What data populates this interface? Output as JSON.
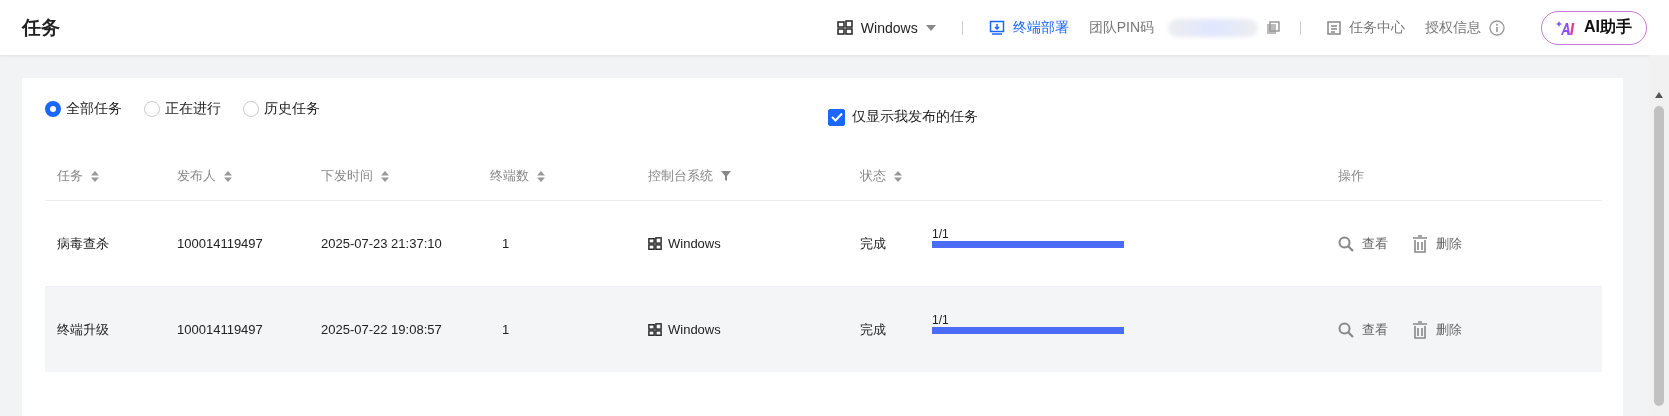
{
  "header": {
    "title": "任务",
    "os_selector": "Windows",
    "deploy_link": "终端部署",
    "team_pin_label": "团队PIN码",
    "task_center": "任务中心",
    "license_info": "授权信息",
    "ai_button": "AI助手"
  },
  "filters": [
    {
      "label": "全部任务",
      "selected": true
    },
    {
      "label": "正在进行",
      "selected": false
    },
    {
      "label": "历史任务",
      "selected": false
    }
  ],
  "only_mine": {
    "label": "仅显示我发布的任务",
    "checked": true
  },
  "table": {
    "columns": [
      {
        "label": "任务",
        "kind": "sort"
      },
      {
        "label": "发布人",
        "kind": "sort"
      },
      {
        "label": "下发时间",
        "kind": "sort"
      },
      {
        "label": "终端数",
        "kind": "sort"
      },
      {
        "label": "控制台系统",
        "kind": "filter"
      },
      {
        "label": "状态",
        "kind": "sort"
      },
      {
        "label": "操作",
        "kind": "plain"
      }
    ],
    "rows": [
      {
        "task": "病毒查杀",
        "publisher": "100014119497",
        "time": "2025-07-23 21:37:10",
        "terminals": "1",
        "os": "Windows",
        "status": "完成",
        "progress_text": "1/1",
        "level": 1,
        "actions": [
          "查看",
          "删除"
        ]
      },
      {
        "task": "终端升级",
        "publisher": "100014119497",
        "time": "2025-07-22 19:08:57",
        "terminals": "1",
        "os": "Windows",
        "status": "完成",
        "progress_text": "1/1",
        "level": 1,
        "actions": [
          "查看",
          "删除"
        ]
      }
    ]
  }
}
